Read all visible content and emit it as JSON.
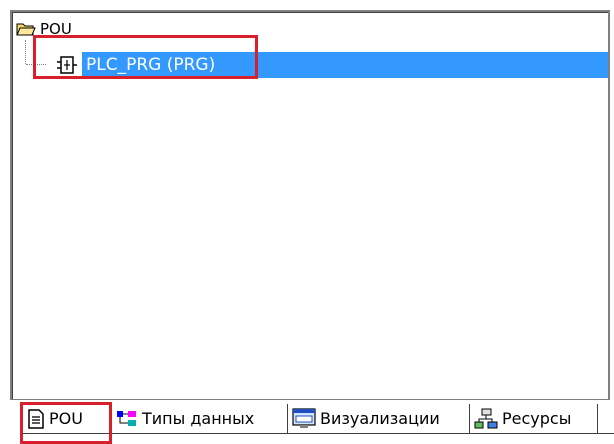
{
  "tree": {
    "root_label": "POU",
    "items": [
      {
        "label": "PLC_PRG (PRG)",
        "selected": true
      }
    ]
  },
  "tabs": [
    {
      "label": "POU",
      "icon": "document-icon",
      "active": true
    },
    {
      "label": "Типы данных",
      "icon": "datatypes-icon",
      "active": false
    },
    {
      "label": "Визуализации",
      "icon": "visualization-icon",
      "active": false
    },
    {
      "label": "Ресурсы",
      "icon": "resources-icon",
      "active": false
    }
  ],
  "colors": {
    "selection": "#3399ff",
    "highlight_annotation": "#d81f2b"
  }
}
